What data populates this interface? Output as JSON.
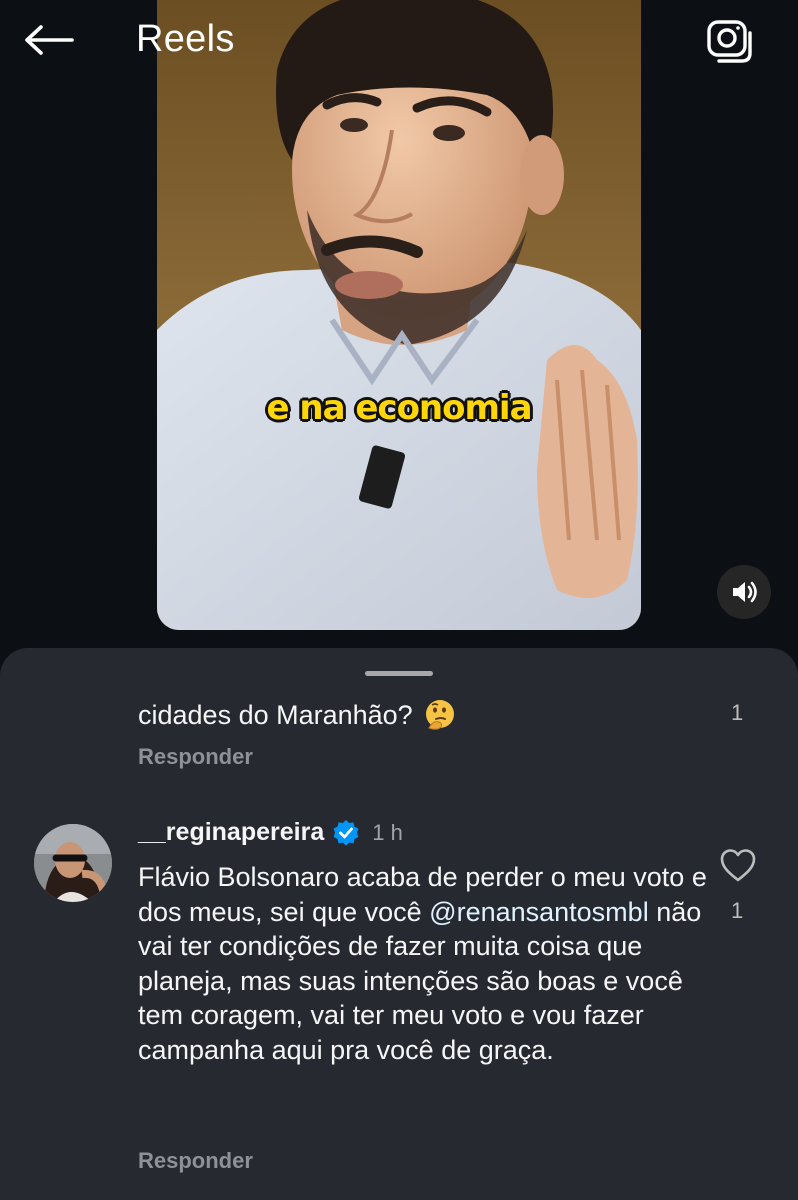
{
  "header": {
    "title": "Reels",
    "back_icon": "arrow-left-icon",
    "camera_icon": "camera-icon"
  },
  "video": {
    "caption": "e na economia",
    "mute_icon": "speaker-icon"
  },
  "comments": [
    {
      "text": "cidades do Maranhão?",
      "emoji": "thinking-face-emoji",
      "likes": "1",
      "reply_label": "Responder"
    },
    {
      "username": "__reginapereira",
      "verified": true,
      "time": "1 h",
      "text_before": "Flávio Bolsonaro acaba de perder o meu voto e dos meus, sei que você ",
      "mention": "@renansantosmbl",
      "text_after": " não vai ter condições de fazer muita coisa que planeja, mas suas intenções são boas e você tem coragem, vai ter meu voto e vou fazer campanha aqui pra você de graça.",
      "likes": "1",
      "reply_label": "Responder"
    }
  ],
  "colors": {
    "background": "#0c1014",
    "sheet": "#262a30",
    "caption": "#ffd60a",
    "verified": "#0095f6"
  }
}
